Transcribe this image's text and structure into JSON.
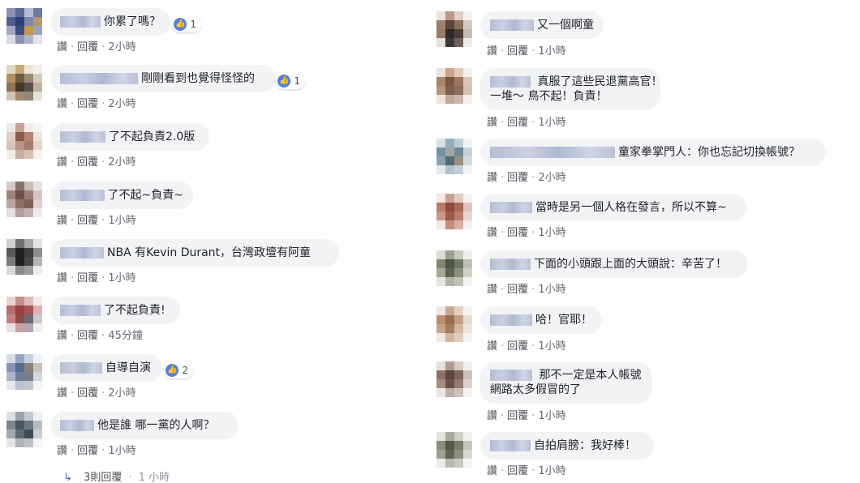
{
  "labels": {
    "like": "讚",
    "reply": "回覆",
    "dot": "·"
  },
  "left_comments": [
    {
      "text": "你累了嗎？",
      "time": "2小時",
      "likes": "1"
    },
    {
      "text": "剛剛看到也覺得怪怪的",
      "time": "2小時",
      "likes": "1"
    },
    {
      "text": "了不起負責2.0版",
      "time": "2小時"
    },
    {
      "text": "了不起~負責~",
      "time": "1小時"
    },
    {
      "text": "NBA 有Kevin Durant，台灣政壇有阿童",
      "time": "1小時"
    },
    {
      "text": "了不起負責!",
      "time": "45分鐘"
    },
    {
      "text": "自導自演",
      "time": "2小時",
      "likes": "2"
    },
    {
      "text": "他是誰 哪一黨的人啊？",
      "time": "1小時"
    }
  ],
  "replies_link": {
    "label": "3則回覆",
    "time": "1 小時"
  },
  "right_comments": [
    {
      "text": "又一個啊童",
      "time": "1小時"
    },
    {
      "line1": "真服了這些民退黨高官！",
      "line2": "一堆～ 鳥不起！負責！",
      "time": "1小時"
    },
    {
      "text": "童家拳掌門人：你也忘記切換帳號？",
      "time": "2小時"
    },
    {
      "text": "當時是另一個人格在發言，所以不算~",
      "time": "1小時"
    },
    {
      "text": "下面的小頭跟上面的大頭說：辛苦了！",
      "time": "1小時"
    },
    {
      "text": "哈！官耶！",
      "time": "1小時"
    },
    {
      "line1": "那不一定是本人帳號",
      "line2": "網路太多假冒的了",
      "time": "1小時"
    },
    {
      "text": "自拍肩膀：我好棒！",
      "time": "1小時"
    }
  ],
  "colors": {
    "bubble": "#f2f3f5",
    "like_blue": "#4f7fe8",
    "meta_text": "#4b4f56",
    "link_blue": "#4267b2"
  },
  "icons": {
    "like": "thumbs-up-icon",
    "reply_arrow": "reply-arrow-icon"
  }
}
